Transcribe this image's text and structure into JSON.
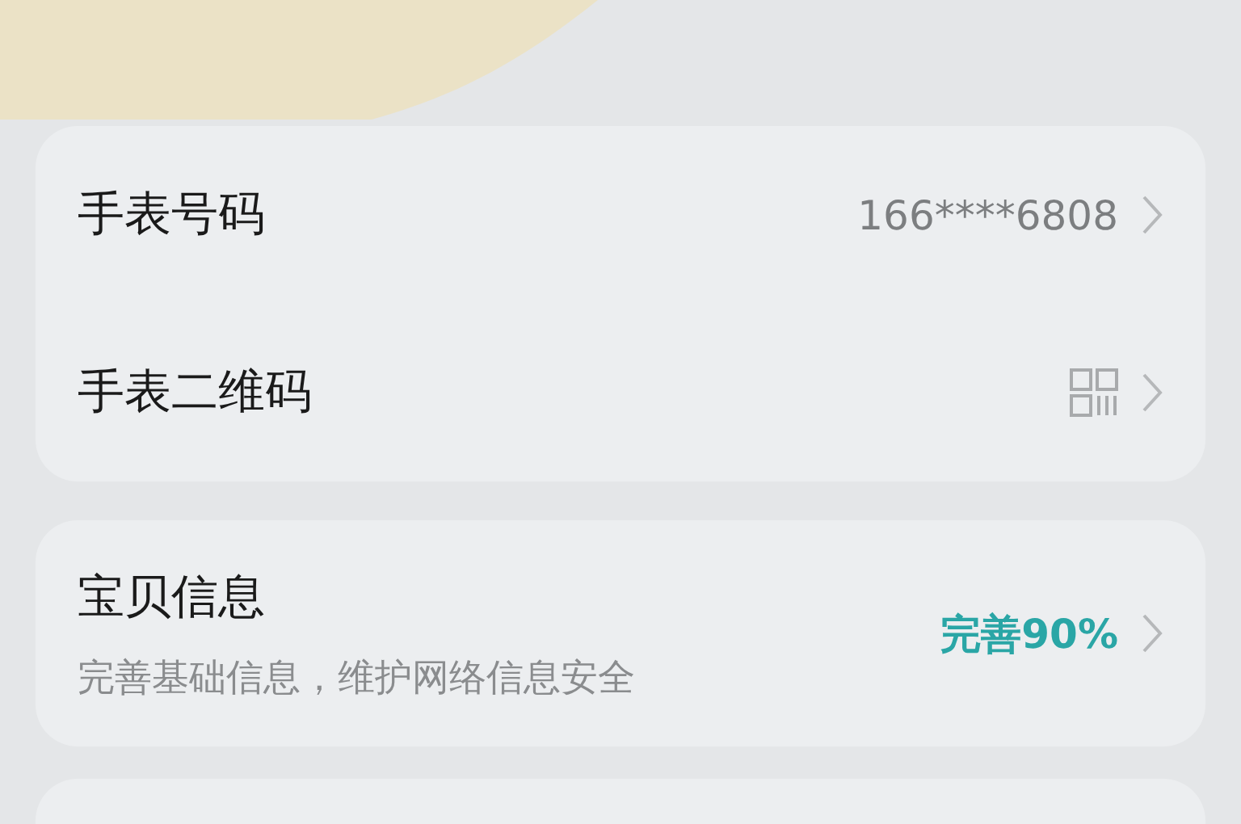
{
  "groups": [
    {
      "rows": [
        {
          "kind": "value",
          "title": "手表号码",
          "value": "166****6808"
        },
        {
          "kind": "qr",
          "title": "手表二维码"
        }
      ]
    },
    {
      "rows": [
        {
          "kind": "progress",
          "title": "宝贝信息",
          "subtitle": "完善基础信息，维护网络信息安全",
          "value": "完善90%"
        }
      ]
    }
  ]
}
